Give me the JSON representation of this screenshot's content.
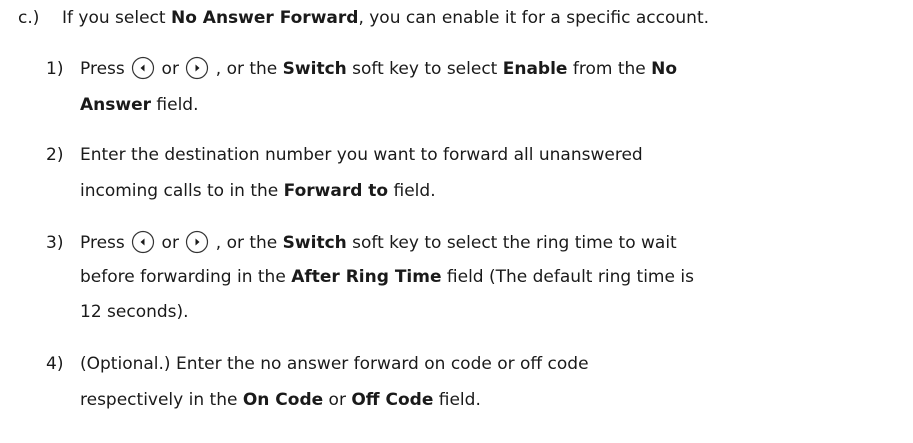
{
  "intro": {
    "marker": "c.)",
    "text_1": "If you select ",
    "bold_1": "No Answer Forward",
    "text_2": ", you can enable it for a specific account."
  },
  "steps": [
    {
      "marker": "1)",
      "l1_t1": "Press ",
      "l1_t2": " or ",
      "l1_t3": " , or the ",
      "l1_b1": "Switch",
      "l1_t4": " soft key to select ",
      "l1_b2": "Enable",
      "l1_t5": " from the ",
      "l1_b3": "No",
      "l2_b1": "Answer",
      "l2_t1": " field."
    },
    {
      "marker": "2)",
      "l1_t1": "Enter the destination number you want to forward all unanswered",
      "l2_t1": "incoming calls to in the ",
      "l2_b1": "Forward to",
      "l2_t2": " field."
    },
    {
      "marker": "3)",
      "l1_t1": "Press ",
      "l1_t2": " or ",
      "l1_t3": " , or the ",
      "l1_b1": "Switch",
      "l1_t4": " soft key to select the ring time to wait",
      "l2_t1": "before forwarding in the ",
      "l2_b1": "After Ring Time",
      "l2_t2": " field (The default ring time is",
      "l3_t1": "12 seconds)."
    },
    {
      "marker": "4)",
      "l1_t1": "(Optional.) Enter the no answer forward on code or off code",
      "l2_t1": "respectively in the ",
      "l2_b1": "On Code",
      "l2_t2": " or ",
      "l2_b2": "Off Code",
      "l2_t3": " field."
    }
  ],
  "icons": {
    "left": "left-navigation-key-icon",
    "right": "right-navigation-key-icon"
  }
}
